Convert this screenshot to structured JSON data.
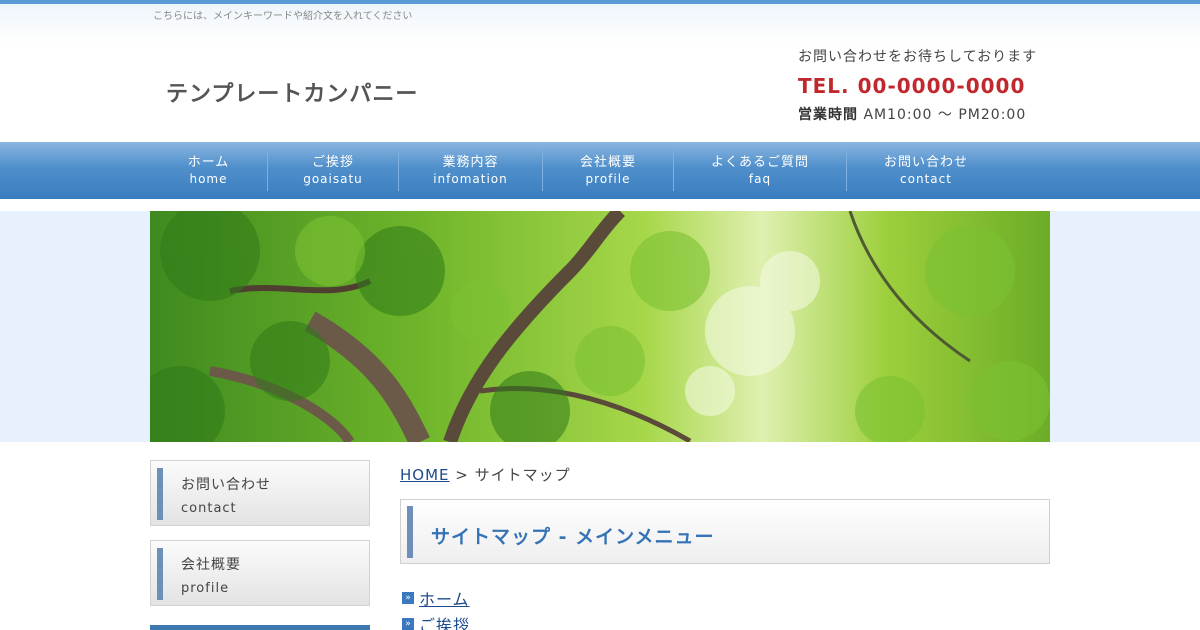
{
  "header": {
    "tagline": "こちらには、メインキーワードや紹介文を入れてください",
    "site_title": "テンプレートカンパニー",
    "contact_message": "お問い合わせをお待ちしております",
    "tel": "TEL. 00-0000-0000",
    "hours_label": "営業時間",
    "hours_value": "AM10:00 ～ PM20:00"
  },
  "nav": {
    "items": [
      {
        "jp": "ホーム",
        "en": "home"
      },
      {
        "jp": "ご挨拶",
        "en": "goaisatu"
      },
      {
        "jp": "業務内容",
        "en": "infomation"
      },
      {
        "jp": "会社概要",
        "en": "profile"
      },
      {
        "jp": "よくあるご質問",
        "en": "faq"
      },
      {
        "jp": "お問い合わせ",
        "en": "contact"
      }
    ]
  },
  "sidebar": {
    "items": [
      {
        "jp": "お問い合わせ",
        "en": "contact"
      },
      {
        "jp": "会社概要",
        "en": "profile"
      }
    ]
  },
  "breadcrumb": {
    "home": "HOME",
    "separator": ">",
    "current": "サイトマップ"
  },
  "main": {
    "heading": "サイトマップ - メインメニュー",
    "links": [
      "ホーム",
      "ご挨拶"
    ]
  },
  "colors": {
    "accent": "#3a7dbf",
    "tel": "#c0282d",
    "heading": "#3573b5"
  }
}
